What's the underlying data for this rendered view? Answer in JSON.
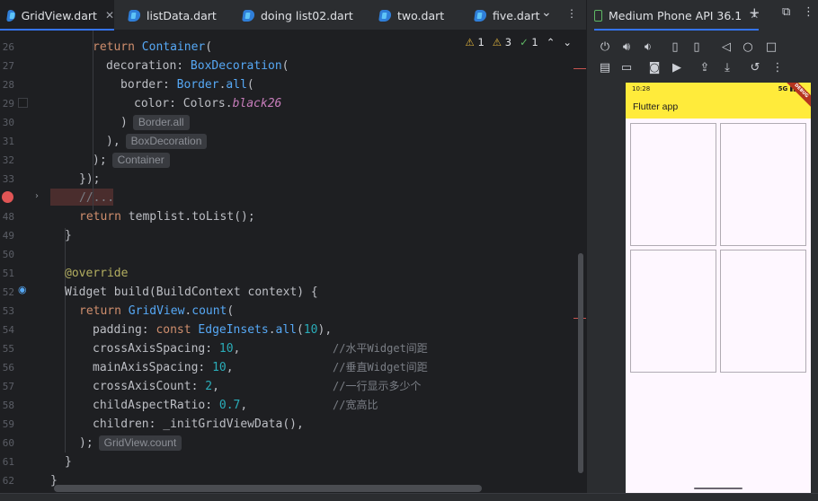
{
  "tabs": [
    {
      "label": "GridView.dart",
      "active": true,
      "closable": true
    },
    {
      "label": "listData.dart",
      "active": false
    },
    {
      "label": "doing list02.dart",
      "active": false
    },
    {
      "label": "two.dart",
      "active": false
    },
    {
      "label": "five.dart",
      "active": false
    }
  ],
  "tab_controls": {
    "more": "⌄",
    "menu": "⋮"
  },
  "inspections": {
    "warning_count": "1",
    "weak_warning_count": "3",
    "ok_count": "1"
  },
  "line_numbers": [
    "26",
    "27",
    "28",
    "29",
    "30",
    "31",
    "32",
    "33",
    "48",
    "49",
    "50",
    "51",
    "52",
    "53",
    "54",
    "55",
    "56",
    "57",
    "58",
    "59",
    "60",
    "61",
    "62"
  ],
  "code": {
    "l26": [
      "return",
      "Container",
      "("
    ],
    "l27": [
      "decoration: ",
      "BoxDecoration",
      "("
    ],
    "l28": [
      "border: ",
      "Border",
      ".",
      "all",
      "("
    ],
    "l29": [
      "color: Colors.",
      "black26"
    ],
    "l30": [
      ")",
      "Border.all"
    ],
    "l31": [
      "),",
      "BoxDecoration"
    ],
    "l32": [
      ");",
      "Container"
    ],
    "l33": "});",
    "l34": "//...",
    "l48": [
      "return",
      " templist.toList();"
    ],
    "l49": "}",
    "l51": "@override",
    "l52": "Widget build(BuildContext context) {",
    "l53": [
      "return",
      "GridView",
      ".",
      "count",
      "("
    ],
    "l54": [
      "padding: ",
      "const",
      "EdgeInsets",
      ".",
      "all",
      "(",
      "10",
      "),"
    ],
    "l55": [
      "crossAxisSpacing: ",
      "10",
      ",",
      "//水平Widget间距"
    ],
    "l56": [
      "mainAxisSpacing: ",
      "10",
      ",",
      "//垂直Widget间距"
    ],
    "l57": [
      "crossAxisCount: ",
      "2",
      ",",
      "//一行显示多少个"
    ],
    "l58": [
      "childAspectRatio: ",
      "0.7",
      ",",
      "//宽高比"
    ],
    "l59": "children: _initGridViewData(),",
    "l60": [
      ");",
      "GridView.count"
    ],
    "l61": "}",
    "l62": "}"
  },
  "devices": {
    "title": "Medium Phone API 36.1",
    "add": "+",
    "toolbar_row1": [
      "power-icon",
      "volume-up-icon",
      "volume-down-icon",
      "rotate-left-icon",
      "rotate-right-icon",
      "back-icon",
      "home-icon",
      "overview-icon"
    ],
    "toolbar_row2": [
      "fold-icon",
      "display-icon",
      "screenshot-icon",
      "screen-record-icon",
      "upload-icon",
      "download-icon",
      "reset-icon",
      "more-icon"
    ]
  },
  "emulator": {
    "time": "10:28",
    "signal": "5G",
    "app_title": "Flutter app",
    "debug_banner": "DEBUG",
    "appbar_color": "#ffeb3b",
    "grid": {
      "columns": 2,
      "items_visible": 4
    }
  },
  "colors": {
    "accent": "#3574f0",
    "breakpoint": "#e05555",
    "editor_bg": "#1e1f22"
  }
}
